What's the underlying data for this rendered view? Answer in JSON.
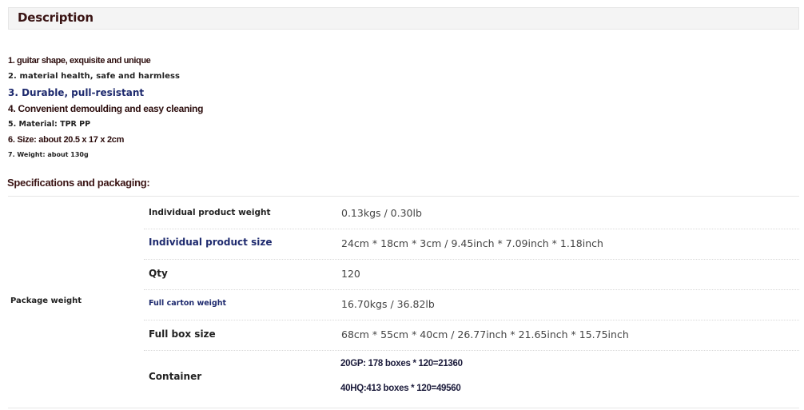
{
  "description": {
    "title": "Description",
    "features": [
      "1. guitar shape, exquisite and unique",
      "2. material health, safe and harmless",
      "3. Durable, pull-resistant",
      "4. Convenient demoulding and easy cleaning",
      "5. Material: TPR PP",
      "6. Size: about 20.5 x 17 x 2cm",
      "7. Weight: about 130g"
    ]
  },
  "specs": {
    "title": "Specifications and packaging:",
    "group_label": "Package weight",
    "rows": [
      {
        "label": "Individual product weight",
        "value": "0.13kgs / 0.30lb"
      },
      {
        "label": "Individual product size",
        "value": "24cm * 18cm * 3cm / 9.45inch * 7.09inch * 1.18inch"
      },
      {
        "label": "Qty",
        "value": "120"
      },
      {
        "label": "Full carton weight",
        "value": "16.70kgs / 36.82lb"
      },
      {
        "label": "Full box size",
        "value": "68cm * 55cm * 40cm / 26.77inch * 21.65inch * 15.75inch"
      }
    ],
    "container": {
      "label": "Container",
      "values": [
        "20GP: 178 boxes * 120=21360",
        "40HQ:413 boxes * 120=49560"
      ]
    }
  },
  "colors": {
    "dark_red": "#2c0d0d",
    "navy": "#1e2a6e",
    "header_bg": "#f4f4f4"
  }
}
